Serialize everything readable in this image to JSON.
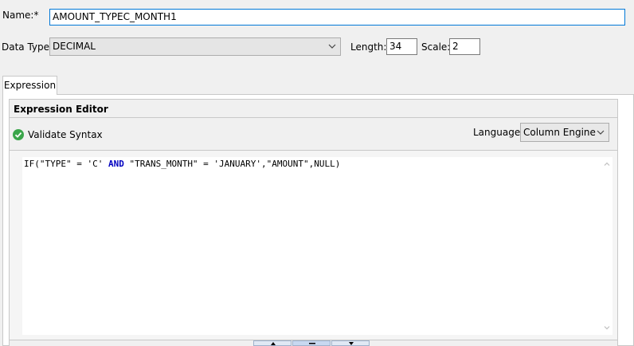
{
  "name_field": {
    "label": "Name:*",
    "value": "AMOUNT_TYPEC_MONTH1"
  },
  "data_type": {
    "label": "Data Type:",
    "selected": "DECIMAL"
  },
  "length": {
    "label": "Length:",
    "value": "34"
  },
  "scale": {
    "label": "Scale:",
    "value": "2"
  },
  "tabs": [
    {
      "label": "Expression",
      "active": true
    }
  ],
  "editor": {
    "title": "Expression Editor",
    "validate_label": "Validate Syntax",
    "language_label": "Language:",
    "language_selected": "Column Engine",
    "expression_tokens": [
      {
        "text": "IF(\"TYPE\" = 'C' ",
        "kw": false
      },
      {
        "text": "AND",
        "kw": true
      },
      {
        "text": " \"TRANS_MONTH\" = 'JANUARY',\"AMOUNT\",NULL)",
        "kw": false
      }
    ]
  },
  "colors": {
    "focus_border": "#0078d7",
    "keyword": "#0000c0",
    "validate_check": "#3aa54a"
  },
  "icons": {
    "validate": "check-circle-icon",
    "dropdown": "chevron-down-icon",
    "scroll_up": "scroll-up-icon",
    "scroll_down": "scroll-down-icon"
  }
}
